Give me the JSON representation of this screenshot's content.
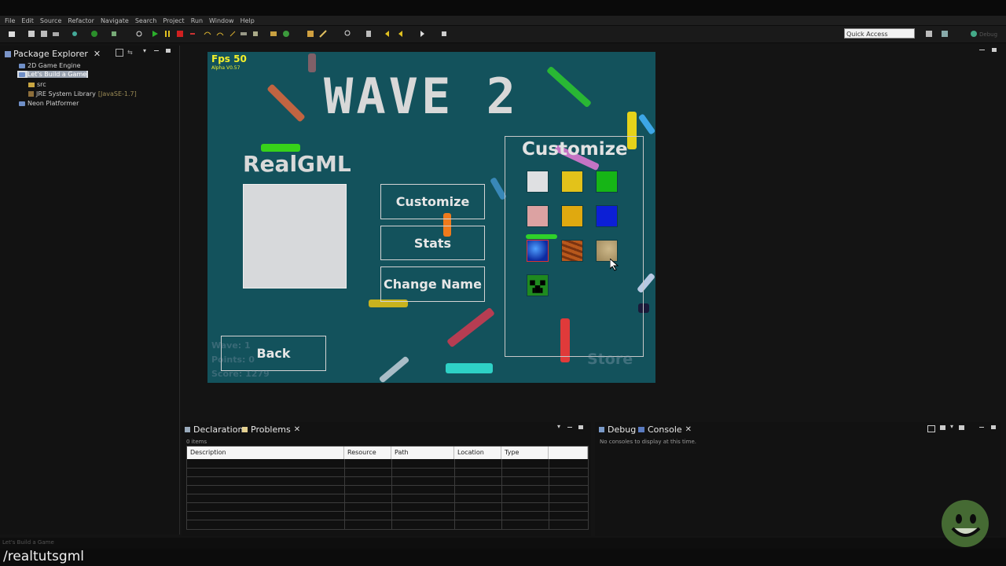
{
  "menu": [
    "File",
    "Edit",
    "Source",
    "Refactor",
    "Navigate",
    "Search",
    "Project",
    "Run",
    "Window",
    "Help"
  ],
  "quick_access_placeholder": "Quick Access",
  "perspective_label": "Debug",
  "explorer": {
    "title": "Package Explorer",
    "items": [
      {
        "label": "2D Game Engine",
        "note": ""
      },
      {
        "label": "Let's Build a Game",
        "note": ""
      },
      {
        "label": "src",
        "note": ""
      },
      {
        "label": "JRE System Library",
        "note": "[JavaSE-1.7]"
      },
      {
        "label": "Neon Platformer",
        "note": ""
      }
    ]
  },
  "game": {
    "fps": "Fps 50",
    "version": "Alpha V0.57",
    "wave_title": "WAVE 2",
    "player_name": "RealGML",
    "buttons": {
      "customize": "Customize",
      "stats": "Stats",
      "change_name": "Change Name",
      "back": "Back"
    },
    "customize_panel_title": "Customize",
    "swatch_colors": [
      "#dfe0e2",
      "#e3c21a",
      "#16b516",
      "#dca2a2",
      "#e0a90f",
      "#0c1fd6"
    ],
    "texture_swatches": [
      "earth-globe",
      "wood-texture",
      "sand-map"
    ],
    "creeper_swatch": "creeper",
    "ghost_hud": {
      "wave": "Wave: 1",
      "points": "Points: 0",
      "score": "Score: 1279"
    },
    "ghost_store": "Store"
  },
  "bottom_left": {
    "tabs": [
      "Declaration",
      "Problems"
    ],
    "item_count": "0 items",
    "columns": [
      "Description",
      "Resource",
      "Path",
      "Location",
      "Type"
    ]
  },
  "bottom_right": {
    "tabs": [
      "Debug",
      "Console"
    ],
    "message": "No consoles to display at this time."
  },
  "status_text": "Let's Build a Game",
  "caption": "/realtutsgml",
  "colors": {
    "game_bg": "#13525c",
    "accent_yellow": "#f4f02a"
  }
}
